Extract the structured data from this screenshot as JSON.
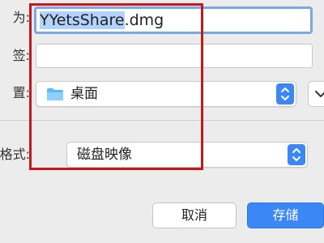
{
  "dialog": {
    "filename_label": "为:",
    "filename_selected": "YYetsShare",
    "filename_ext": ".dmg",
    "tags_label": "签:",
    "tags_value": "",
    "where_label": "置:",
    "where_value": "桌面",
    "format_label": "格式:",
    "format_value": "磁盘映像",
    "cancel_label": "取消",
    "save_label": "存储"
  },
  "colors": {
    "accent": "#3b87f6",
    "highlight_box": "#c8161d",
    "selection": "#b2d3fc"
  },
  "icons": [
    "folder-icon",
    "stepper-arrows-icon",
    "chevron-down-icon"
  ]
}
